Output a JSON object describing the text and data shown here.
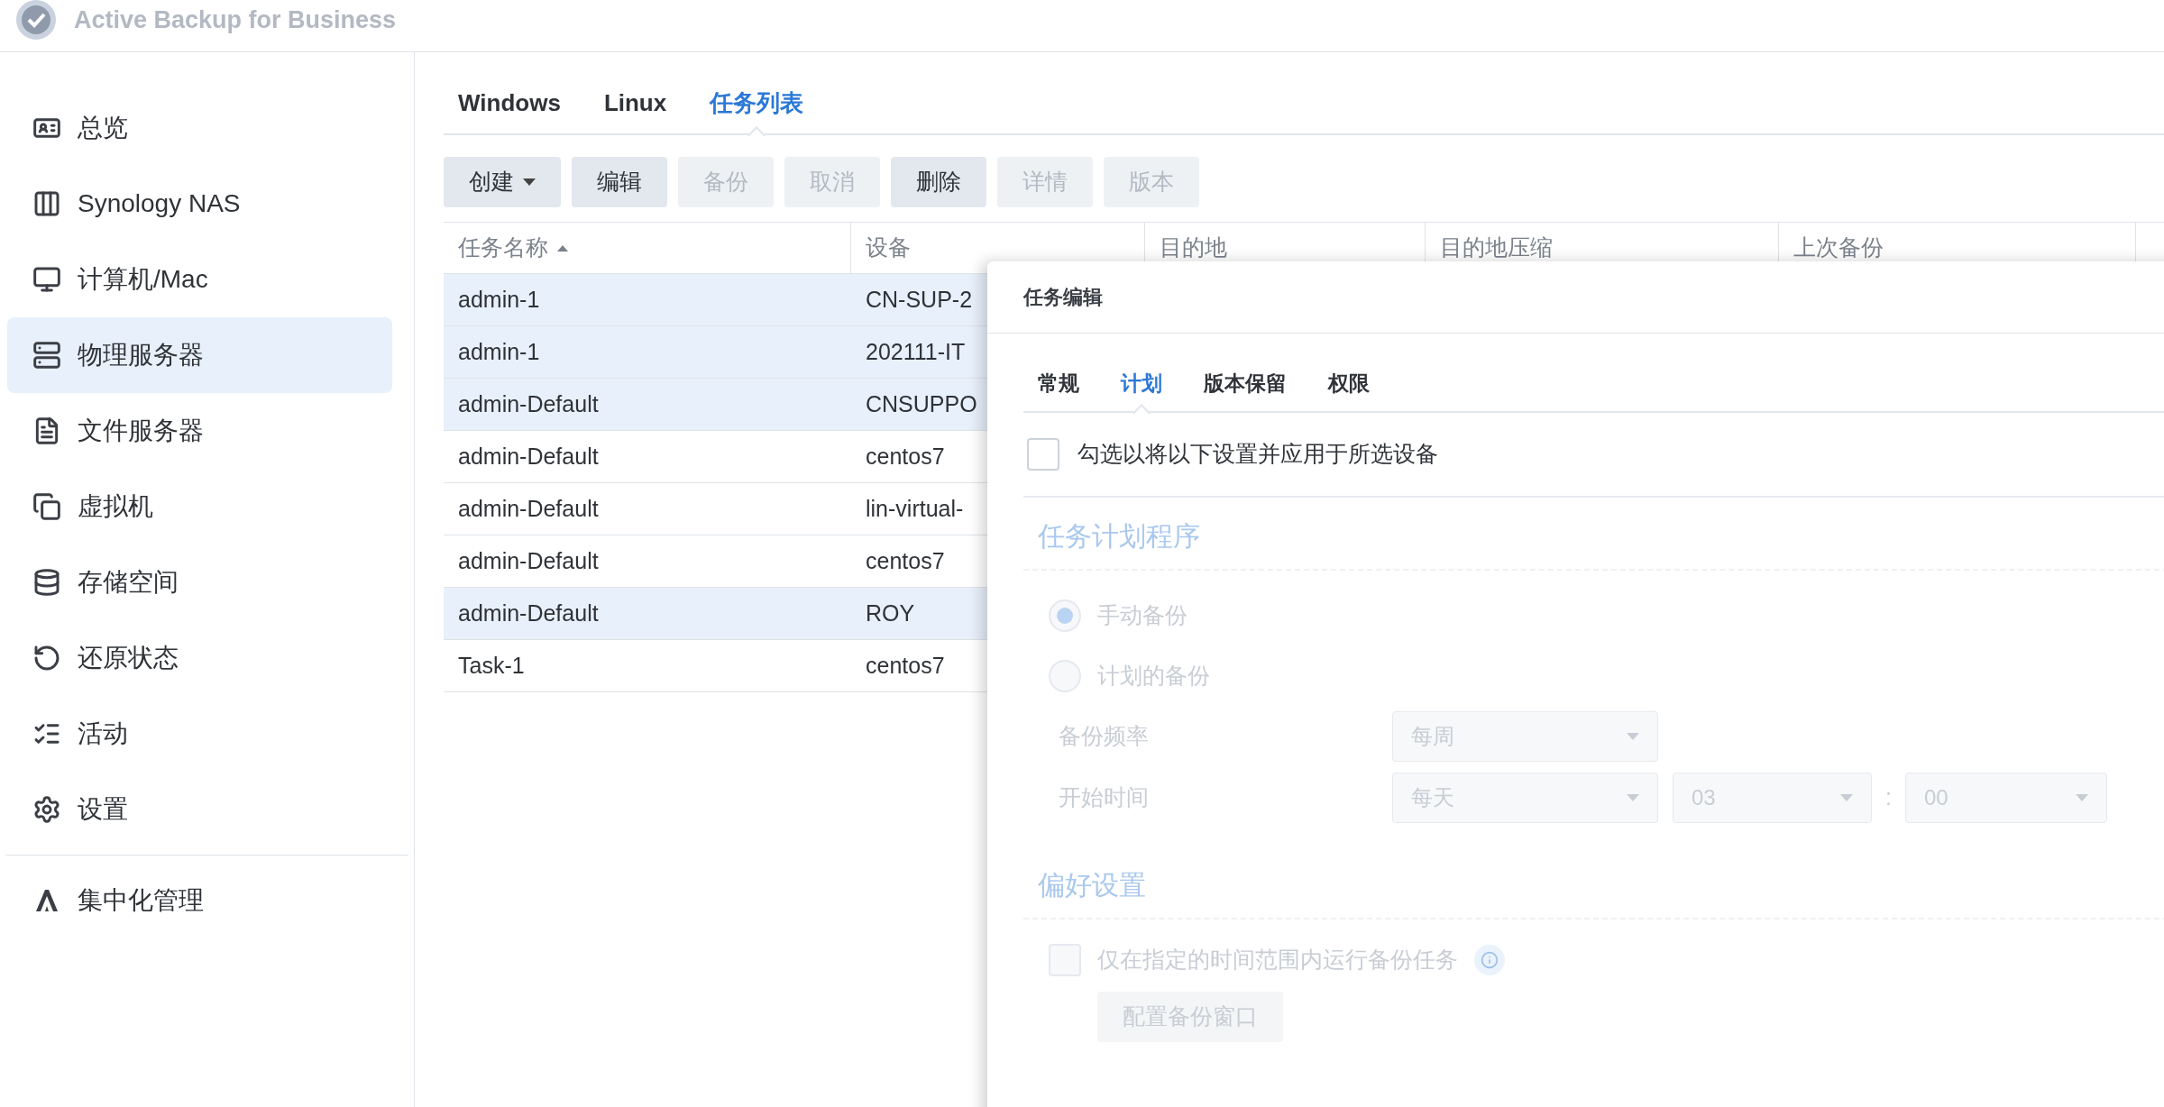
{
  "app": {
    "title": "Active Backup for Business"
  },
  "sidebar": {
    "items": [
      {
        "label": "总览",
        "selected": false
      },
      {
        "label": "Synology NAS",
        "selected": false
      },
      {
        "label": "计算机/Mac",
        "selected": false
      },
      {
        "label": "物理服务器",
        "selected": true
      },
      {
        "label": "文件服务器",
        "selected": false
      },
      {
        "label": "虚拟机",
        "selected": false
      },
      {
        "label": "存储空间",
        "selected": false
      },
      {
        "label": "还原状态",
        "selected": false
      },
      {
        "label": "活动",
        "selected": false
      },
      {
        "label": "设置",
        "selected": false
      }
    ],
    "bottom_items": [
      {
        "label": "集中化管理",
        "selected": false
      }
    ]
  },
  "tabs": [
    {
      "label": "Windows",
      "selected": false
    },
    {
      "label": "Linux",
      "selected": false
    },
    {
      "label": "任务列表",
      "selected": true
    }
  ],
  "toolbar": [
    {
      "label": "创建",
      "disabled": false,
      "dropdown": true
    },
    {
      "label": "编辑",
      "disabled": false,
      "dropdown": false
    },
    {
      "label": "备份",
      "disabled": true,
      "dropdown": false
    },
    {
      "label": "取消",
      "disabled": true,
      "dropdown": false
    },
    {
      "label": "删除",
      "disabled": false,
      "dropdown": false
    },
    {
      "label": "详情",
      "disabled": true,
      "dropdown": false
    },
    {
      "label": "版本",
      "disabled": true,
      "dropdown": false
    }
  ],
  "table": {
    "columns": [
      {
        "label": "任务名称",
        "sorted": true
      },
      {
        "label": "设备",
        "sorted": false
      },
      {
        "label": "目的地",
        "sorted": false
      },
      {
        "label": "目的地压缩",
        "sorted": false
      },
      {
        "label": "上次备份",
        "sorted": false
      }
    ],
    "rows": [
      {
        "selected": true,
        "cells": [
          "admin-1",
          "CN-SUP-2"
        ]
      },
      {
        "selected": true,
        "cells": [
          "admin-1",
          "202111-IT"
        ]
      },
      {
        "selected": true,
        "cells": [
          "admin-Default",
          "CNSUPPO"
        ]
      },
      {
        "selected": false,
        "cells": [
          "admin-Default",
          "centos7"
        ]
      },
      {
        "selected": false,
        "cells": [
          "admin-Default",
          "lin-virtual-"
        ]
      },
      {
        "selected": false,
        "cells": [
          "admin-Default",
          "centos7"
        ]
      },
      {
        "selected": true,
        "cells": [
          "admin-Default",
          "ROY"
        ]
      },
      {
        "selected": false,
        "cells": [
          "Task-1",
          "centos7"
        ]
      }
    ]
  },
  "dialog": {
    "title": "任务编辑",
    "tabs": [
      {
        "label": "常规",
        "selected": false
      },
      {
        "label": "计划",
        "selected": true
      },
      {
        "label": "版本保留",
        "selected": false
      },
      {
        "label": "权限",
        "selected": false
      }
    ],
    "apply_checkbox": {
      "label": "勾选以将以下设置并应用于所选设备",
      "checked": false
    },
    "form_disabled": true,
    "schedule": {
      "title": "任务计划程序",
      "options": [
        {
          "label": "手动备份",
          "selected": true
        },
        {
          "label": "计划的备份",
          "selected": false
        }
      ],
      "frequency": {
        "label": "备份频率",
        "value": "每周"
      },
      "start_time": {
        "label": "开始时间",
        "day": "每天",
        "hour": "03",
        "separator": ":",
        "minute": "00"
      }
    },
    "preferences": {
      "title": "偏好设置",
      "checkbox": {
        "label": "仅在指定的时间范围内运行备份任务",
        "checked": false
      },
      "button": "配置备份窗口"
    }
  }
}
